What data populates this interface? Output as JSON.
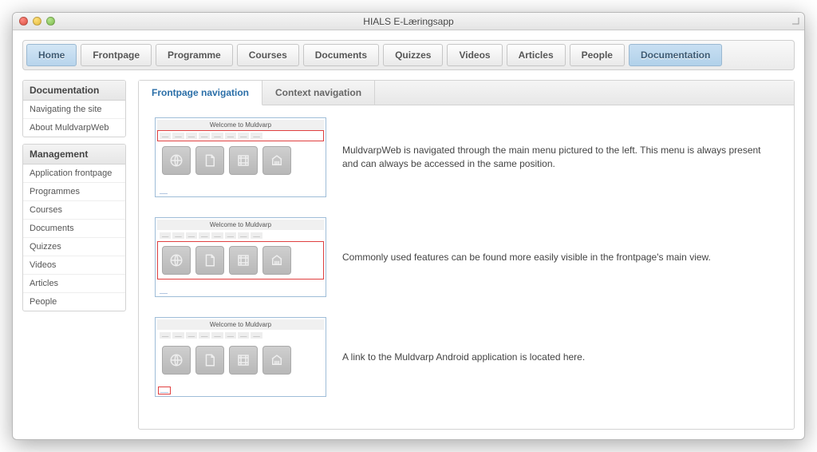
{
  "window": {
    "title": "HIALS E-Læringsapp"
  },
  "nav": {
    "items": [
      {
        "label": "Home",
        "state": "active-home"
      },
      {
        "label": "Frontpage",
        "state": ""
      },
      {
        "label": "Programme",
        "state": ""
      },
      {
        "label": "Courses",
        "state": ""
      },
      {
        "label": "Documents",
        "state": ""
      },
      {
        "label": "Quizzes",
        "state": ""
      },
      {
        "label": "Videos",
        "state": ""
      },
      {
        "label": "Articles",
        "state": ""
      },
      {
        "label": "People",
        "state": ""
      },
      {
        "label": "Documentation",
        "state": "active-doc"
      }
    ]
  },
  "sidebar": {
    "groups": [
      {
        "header": "Documentation",
        "items": [
          "Navigating the site",
          "About MuldvarpWeb"
        ]
      },
      {
        "header": "Management",
        "items": [
          "Application frontpage",
          "Programmes",
          "Courses",
          "Documents",
          "Quizzes",
          "Videos",
          "Articles",
          "People"
        ]
      }
    ]
  },
  "tabs": {
    "items": [
      {
        "label": "Frontpage navigation",
        "active": true
      },
      {
        "label": "Context navigation",
        "active": false
      }
    ]
  },
  "thumb": {
    "title": "Welcome to Muldvarp"
  },
  "docs": {
    "rows": [
      {
        "text": "MuldvarpWeb is navigated through the main menu pictured to the left. This menu is always present and can always be accessed in the same position.",
        "highlight": "menu"
      },
      {
        "text": "Commonly used features can be found more easily visible in the frontpage's main view.",
        "highlight": "icons"
      },
      {
        "text": "A link to the Muldvarp Android application is located here.",
        "highlight": "footer"
      }
    ]
  }
}
